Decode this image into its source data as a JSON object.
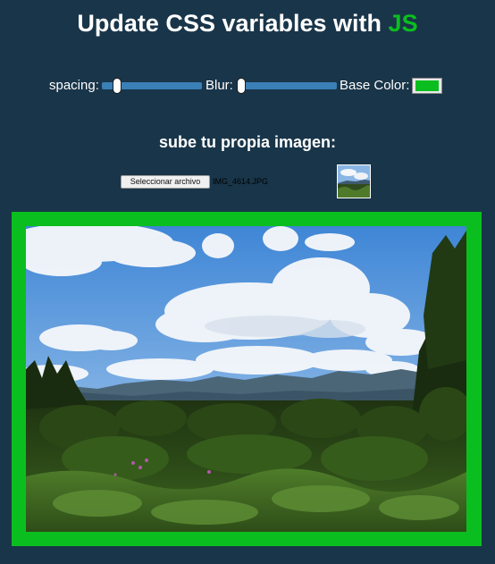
{
  "header": {
    "title_main": "Update CSS variables with",
    "title_highlight": "JS"
  },
  "controls": {
    "spacing_label": "spacing:",
    "spacing_value": 0.12,
    "blur_label": "Blur:",
    "blur_value": 0.0,
    "base_color_label": "Base Color:",
    "base_color_value": "#0bbe1f"
  },
  "upload": {
    "heading": "sube tu propia imagen:",
    "button_label": "Seleccionar archivo",
    "file_name": "IMG_4614.JPG"
  },
  "colors": {
    "background": "#193549",
    "accent": "#0bbe1f",
    "slider_track": "#3b7fb7"
  }
}
